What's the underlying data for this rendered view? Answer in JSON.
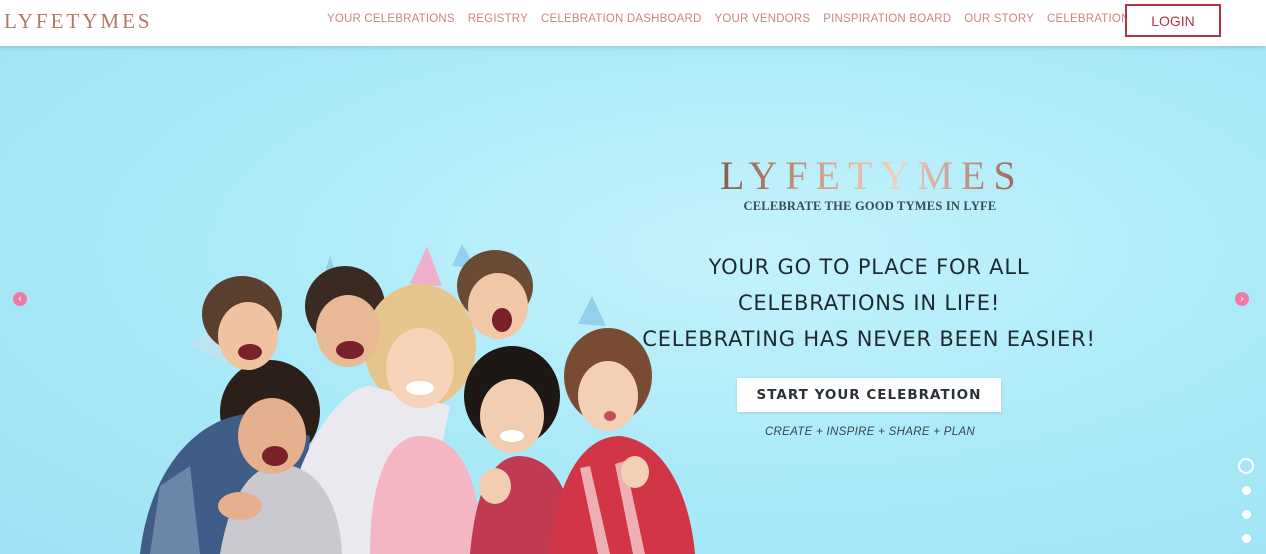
{
  "header": {
    "logo": "LYFETYMES",
    "nav": [
      {
        "label": "YOUR CELEBRATIONS"
      },
      {
        "label": "REGISTRY"
      },
      {
        "label": "CELEBRATION DASHBOARD"
      },
      {
        "label": "YOUR VENDORS"
      },
      {
        "label": "PINSPIRATION BOARD"
      },
      {
        "label": "OUR STORY"
      },
      {
        "label": "CELEBRATION TIPS"
      }
    ],
    "login_label": "LOGIN"
  },
  "hero": {
    "logo": "LYFETYMES",
    "tagline": "CELEBRATE THE GOOD TYMES IN LYFE",
    "headline_lines": [
      "YOUR GO TO PLACE FOR ALL",
      "CELEBRATIONS IN LIFE!",
      "CELEBRATING HAS NEVER BEEN EASIER!"
    ],
    "cta_label": "START YOUR CELEBRATION",
    "sub_caption": "CREATE + INSPIRE + SHARE + PLAN",
    "prev_icon": "chevron-left-icon",
    "next_icon": "chevron-right-icon",
    "slide_count": 4,
    "active_slide": 1
  },
  "colors": {
    "brand": "#b07a64",
    "nav_text": "#c9877a",
    "login_border": "#b5343f",
    "hero_bg": "#aeeaf8",
    "arrow": "#f07aa7"
  }
}
